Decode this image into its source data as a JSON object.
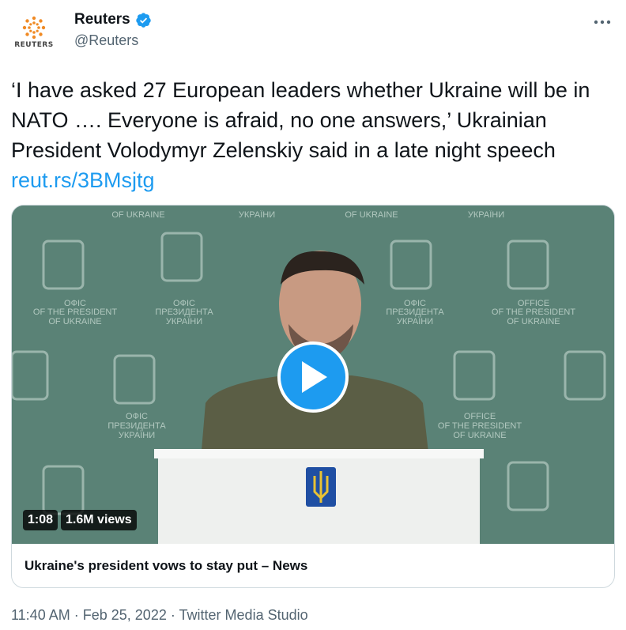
{
  "header": {
    "logo_text": "REUTERS",
    "display_name": "Reuters",
    "handle": "@Reuters"
  },
  "tweet": {
    "text": "‘I have asked 27 European leaders whether Ukraine will be in NATO …. Everyone is afraid, no one answers,’ Ukrainian President Volodymyr Zelenskiy said in a late night speech ",
    "link": "reut.rs/3BMsjtg"
  },
  "media": {
    "backdrop_lines": [
      [
        "ОФІС",
        "OFFICE",
        "OF THE PRESIDENT",
        "OF UKRAINE"
      ],
      [
        "ОФІС",
        "ПРЕЗИДЕНТА",
        "УКРАЇНИ"
      ],
      [
        "OF UKRAINE",
        "УКРАЇНИ"
      ]
    ],
    "duration": "1:08",
    "views": "1.6M views"
  },
  "card": {
    "title": "Ukraine's president vows to stay put – News"
  },
  "footer": {
    "time": "11:40 AM",
    "separator": "·",
    "date": "Feb 25, 2022",
    "source": "Twitter Media Studio"
  },
  "colors": {
    "link": "#1d9bf0",
    "backdrop": "#5a8276",
    "secondary_text": "#536471"
  }
}
